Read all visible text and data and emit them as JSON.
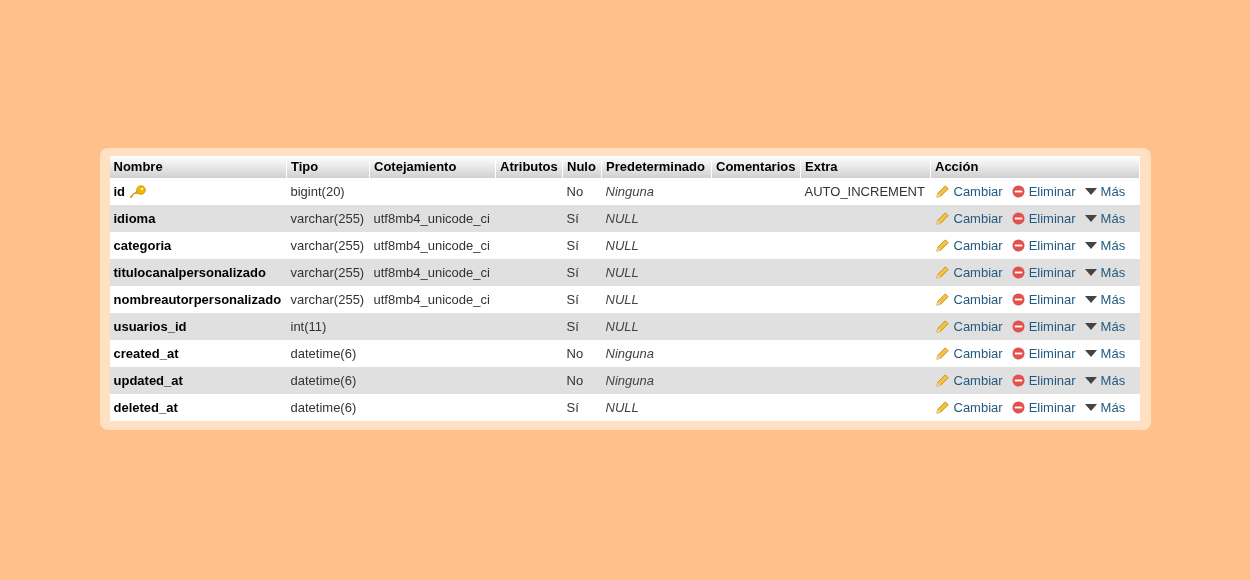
{
  "table": {
    "columns": [
      "Nombre",
      "Tipo",
      "Cotejamiento",
      "Atributos",
      "Nulo",
      "Predeterminado",
      "Comentarios",
      "Extra",
      "Acción"
    ],
    "rows": [
      {
        "name": "id",
        "primary": true,
        "type": "bigint(20)",
        "null": "No",
        "default": "Ninguna",
        "extra": "AUTO_INCREMENT",
        "actions": [
          {
            "kind": "edit",
            "label": "Cambiar"
          },
          {
            "kind": "delete",
            "label": "Eliminar"
          },
          {
            "kind": "more",
            "label": "Más"
          }
        ]
      },
      {
        "name": "idioma",
        "primary": false,
        "type": "varchar(255)",
        "collation": "utf8mb4_unicode_ci",
        "null": "Sí",
        "default": "NULL",
        "actions": [
          {
            "kind": "edit",
            "label": "Cambiar"
          },
          {
            "kind": "delete",
            "label": "Eliminar"
          },
          {
            "kind": "more",
            "label": "Más"
          }
        ]
      },
      {
        "name": "categoria",
        "primary": false,
        "type": "varchar(255)",
        "collation": "utf8mb4_unicode_ci",
        "null": "Sí",
        "default": "NULL",
        "actions": [
          {
            "kind": "edit",
            "label": "Cambiar"
          },
          {
            "kind": "delete",
            "label": "Eliminar"
          },
          {
            "kind": "more",
            "label": "Más"
          }
        ]
      },
      {
        "name": "titulocanalpersonalizado",
        "primary": false,
        "type": "varchar(255)",
        "collation": "utf8mb4_unicode_ci",
        "null": "Sí",
        "default": "NULL",
        "actions": [
          {
            "kind": "edit",
            "label": "Cambiar"
          },
          {
            "kind": "delete",
            "label": "Eliminar"
          },
          {
            "kind": "more",
            "label": "Más"
          }
        ]
      },
      {
        "name": "nombreautorpersonalizado",
        "primary": false,
        "type": "varchar(255)",
        "collation": "utf8mb4_unicode_ci",
        "null": "Sí",
        "default": "NULL",
        "actions": [
          {
            "kind": "edit",
            "label": "Cambiar"
          },
          {
            "kind": "delete",
            "label": "Eliminar"
          },
          {
            "kind": "more",
            "label": "Más"
          }
        ]
      },
      {
        "name": "usuarios_id",
        "primary": false,
        "type": "int(11)",
        "null": "Sí",
        "default": "NULL",
        "actions": [
          {
            "kind": "edit",
            "label": "Cambiar"
          },
          {
            "kind": "delete",
            "label": "Eliminar"
          },
          {
            "kind": "more",
            "label": "Más"
          }
        ]
      },
      {
        "name": "created_at",
        "primary": false,
        "type": "datetime(6)",
        "null": "No",
        "default": "Ninguna",
        "actions": [
          {
            "kind": "edit",
            "label": "Cambiar"
          },
          {
            "kind": "delete",
            "label": "Eliminar"
          },
          {
            "kind": "more",
            "label": "Más"
          }
        ]
      },
      {
        "name": "updated_at",
        "primary": false,
        "type": "datetime(6)",
        "null": "No",
        "default": "Ninguna",
        "actions": [
          {
            "kind": "edit",
            "label": "Cambiar"
          },
          {
            "kind": "delete",
            "label": "Eliminar"
          },
          {
            "kind": "more",
            "label": "Más"
          }
        ]
      },
      {
        "name": "deleted_at",
        "primary": false,
        "type": "datetime(6)",
        "null": "Sí",
        "default": "NULL",
        "actions": [
          {
            "kind": "edit",
            "label": "Cambiar"
          },
          {
            "kind": "delete",
            "label": "Eliminar"
          },
          {
            "kind": "more",
            "label": "Más"
          }
        ]
      }
    ]
  }
}
